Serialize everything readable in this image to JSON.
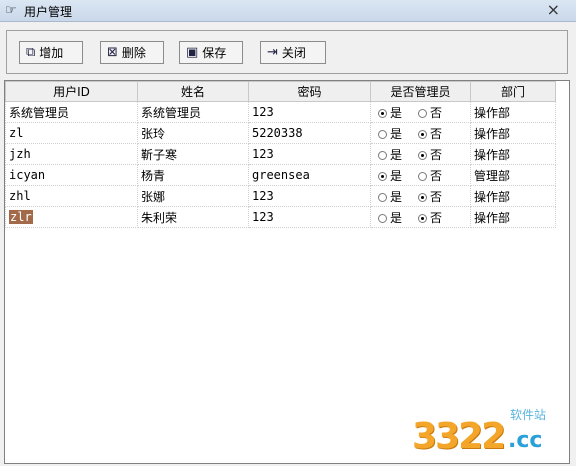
{
  "window": {
    "title": "用户管理",
    "close_glyph": "×"
  },
  "toolbar": {
    "add_label": "增加",
    "delete_label": "删除",
    "save_label": "保存",
    "close_label": "关闭"
  },
  "columns": [
    "用户ID",
    "姓名",
    "密码",
    "是否管理员",
    "部门"
  ],
  "admin_yes": "是",
  "admin_no": "否",
  "rows": [
    {
      "id": "系统管理员",
      "name": "系统管理员",
      "password": "123",
      "admin": true,
      "dept": "操作部"
    },
    {
      "id": "zl",
      "name": "张玲",
      "password": "5220338",
      "admin": false,
      "dept": "操作部"
    },
    {
      "id": "jzh",
      "name": "靳子寒",
      "password": "123",
      "admin": false,
      "dept": "操作部"
    },
    {
      "id": "icyan",
      "name": "杨青",
      "password": "greensea",
      "admin": true,
      "dept": "管理部"
    },
    {
      "id": "zhl",
      "name": "张娜",
      "password": "123",
      "admin": false,
      "dept": "操作部"
    },
    {
      "id": "zlr",
      "name": "朱利荣",
      "password": "123",
      "admin": false,
      "dept": "操作部"
    }
  ],
  "watermark": {
    "big": "3322",
    "cc": ".cc",
    "small": "软件站"
  },
  "colors": {
    "selection": "#a36a4a",
    "watermark_orange": "#f4a62a",
    "watermark_blue": "#2aa0d8"
  }
}
